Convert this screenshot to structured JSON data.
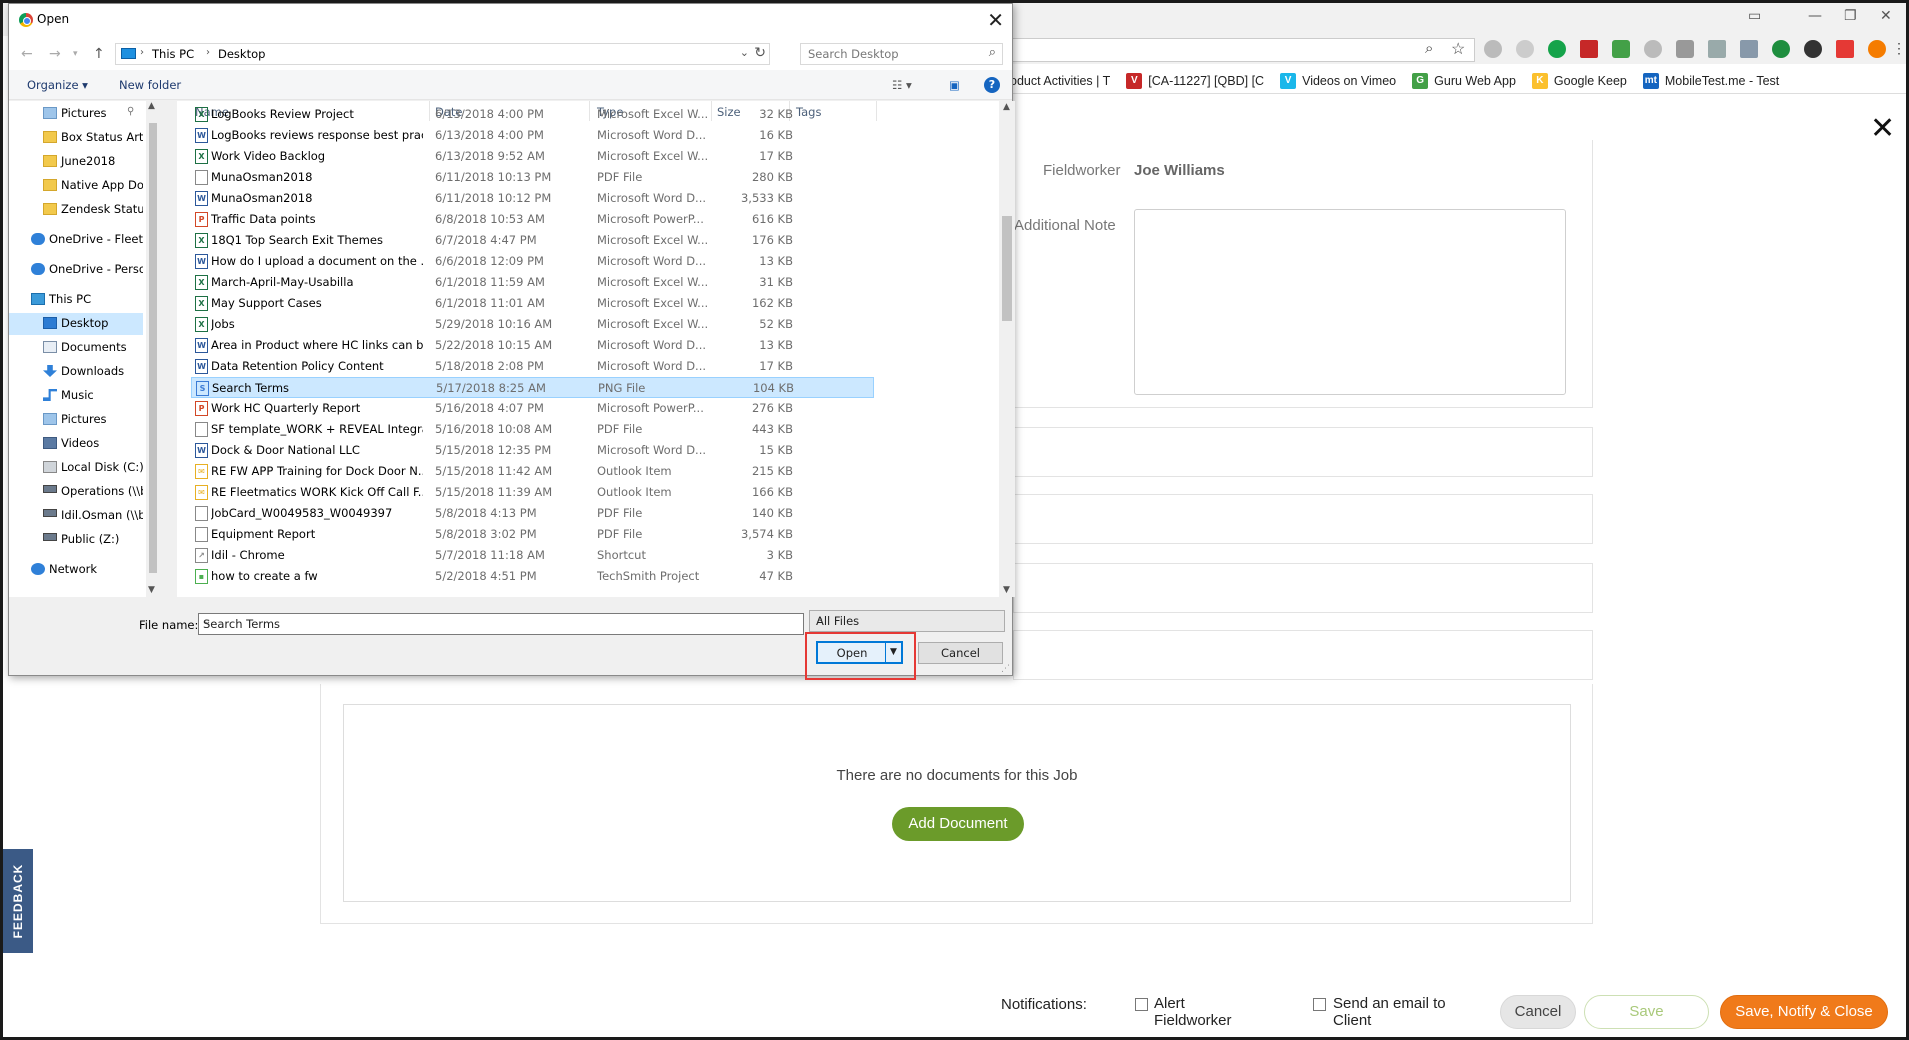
{
  "browser": {
    "minimize_glyph": "—",
    "restore_glyph": "❐",
    "close_glyph": "✕",
    "omnibox_icons": [
      "search-icon",
      "star-icon"
    ],
    "bookmarks": [
      {
        "label": "oduct Activities | T",
        "icon_color": "#888888",
        "icon": ""
      },
      {
        "label": "[CA-11227] [QBD] [C",
        "icon_color": "#c62828",
        "icon": "V"
      },
      {
        "label": "Videos on Vimeo",
        "icon_color": "#1ab7ea",
        "icon": "V"
      },
      {
        "label": "Guru Web App",
        "icon_color": "#43a047",
        "icon": "G"
      },
      {
        "label": "Google Keep",
        "icon_color": "#fbc02d",
        "icon": "K"
      },
      {
        "label": "MobileTest.me - Test",
        "icon_color": "#1565c0",
        "icon": "mt"
      }
    ]
  },
  "page": {
    "close_glyph": "✕",
    "fieldworker_label": "Fieldworker",
    "fieldworker_value": "Joe Williams",
    "additional_note_label": "Additional Note",
    "no_documents_text": "There are no documents for this Job",
    "add_document_label": "Add Document",
    "feedback_label": "FEEDBACK",
    "notifications_label": "Notifications:",
    "alert_fieldworker_label": "Alert Fieldworker",
    "alert_line1": "Alert",
    "alert_line2": "Fieldworker",
    "send_email_line1": "Send an email to",
    "send_email_line2": "Client",
    "cancel_label": "Cancel",
    "save_label": "Save",
    "save_notify_close_label": "Save, Notify & Close",
    "accent_green": "#6b9b2a",
    "accent_orange": "#f07a1a"
  },
  "dialog": {
    "title": "Open",
    "close_glyph": "✕",
    "breadcrumb": [
      "This PC",
      "Desktop"
    ],
    "search_placeholder": "Search Desktop",
    "toolbar": {
      "organize": "Organize ▾",
      "new_folder": "New folder",
      "help": "?"
    },
    "nav_items": [
      {
        "label": "Pictures",
        "kind": "folder-blue",
        "pinned": true
      },
      {
        "label": "Box Status Articl",
        "kind": "folder"
      },
      {
        "label": "June2018",
        "kind": "folder"
      },
      {
        "label": "Native App Docs",
        "kind": "folder"
      },
      {
        "label": "Zendesk Status A",
        "kind": "folder"
      },
      {
        "label": "",
        "kind": "spacer"
      },
      {
        "label": "OneDrive - Fleetm",
        "kind": "cloud"
      },
      {
        "label": "",
        "kind": "spacer"
      },
      {
        "label": "OneDrive - Persor",
        "kind": "cloud"
      },
      {
        "label": "",
        "kind": "spacer"
      },
      {
        "label": "This PC",
        "kind": "pc"
      },
      {
        "label": "Desktop",
        "kind": "desktop",
        "selected": true
      },
      {
        "label": "Documents",
        "kind": "docs"
      },
      {
        "label": "Downloads",
        "kind": "downloads"
      },
      {
        "label": "Music",
        "kind": "music"
      },
      {
        "label": "Pictures",
        "kind": "folder-blue"
      },
      {
        "label": "Videos",
        "kind": "videos"
      },
      {
        "label": "Local Disk (C:)",
        "kind": "disk"
      },
      {
        "label": "Operations (\\\\bc",
        "kind": "netdrive"
      },
      {
        "label": "Idil.Osman (\\\\bc",
        "kind": "netdrive"
      },
      {
        "label": "Public (Z:)",
        "kind": "netdrive"
      },
      {
        "label": "",
        "kind": "spacer"
      },
      {
        "label": "Network",
        "kind": "network"
      }
    ],
    "columns": [
      "Name",
      "Date",
      "Type",
      "Size",
      "Tags"
    ],
    "files": [
      {
        "name": "LogBooks Review Project",
        "date": "6/13/2018 4:00 PM",
        "type": "Microsoft Excel W...",
        "size": "32 KB",
        "icon": "excel"
      },
      {
        "name": "LogBooks reviews response best prac...",
        "date": "6/13/2018 4:00 PM",
        "type": "Microsoft Word D...",
        "size": "16 KB",
        "icon": "word"
      },
      {
        "name": "Work Video Backlog",
        "date": "6/13/2018 9:52 AM",
        "type": "Microsoft Excel W...",
        "size": "17 KB",
        "icon": "excel"
      },
      {
        "name": "MunaOsman2018",
        "date": "6/11/2018 10:13 PM",
        "type": "PDF File",
        "size": "280 KB",
        "icon": "pdf"
      },
      {
        "name": "MunaOsman2018",
        "date": "6/11/2018 10:12 PM",
        "type": "Microsoft Word D...",
        "size": "3,533 KB",
        "icon": "word"
      },
      {
        "name": "Traffic Data points",
        "date": "6/8/2018 10:53 AM",
        "type": "Microsoft PowerP...",
        "size": "616 KB",
        "icon": "ppt"
      },
      {
        "name": "18Q1 Top Search Exit Themes",
        "date": "6/7/2018 4:47 PM",
        "type": "Microsoft Excel W...",
        "size": "176 KB",
        "icon": "excel"
      },
      {
        "name": "How do I upload a document on the ...",
        "date": "6/6/2018 12:09 PM",
        "type": "Microsoft Word D...",
        "size": "13 KB",
        "icon": "word"
      },
      {
        "name": "March-April-May-Usabilla",
        "date": "6/1/2018 11:59 AM",
        "type": "Microsoft Excel W...",
        "size": "31 KB",
        "icon": "excel"
      },
      {
        "name": "May Support Cases",
        "date": "6/1/2018 11:01 AM",
        "type": "Microsoft Excel W...",
        "size": "162 KB",
        "icon": "excel"
      },
      {
        "name": "Jobs",
        "date": "5/29/2018 10:16 AM",
        "type": "Microsoft Excel W...",
        "size": "52 KB",
        "icon": "excel"
      },
      {
        "name": "Area in Product where HC links can b...",
        "date": "5/22/2018 10:15 AM",
        "type": "Microsoft Word D...",
        "size": "13 KB",
        "icon": "word"
      },
      {
        "name": "Data Retention Policy Content",
        "date": "5/18/2018 2:08 PM",
        "type": "Microsoft Word D...",
        "size": "17 KB",
        "icon": "word"
      },
      {
        "name": "Search Terms",
        "date": "5/17/2018 8:25 AM",
        "type": "PNG File",
        "size": "104 KB",
        "icon": "png",
        "selected": true
      },
      {
        "name": "Work HC Quarterly Report",
        "date": "5/16/2018 4:07 PM",
        "type": "Microsoft PowerP...",
        "size": "276 KB",
        "icon": "ppt"
      },
      {
        "name": "SF template_WORK + REVEAL Integra...",
        "date": "5/16/2018 10:08 AM",
        "type": "PDF File",
        "size": "443 KB",
        "icon": "pdf"
      },
      {
        "name": "Dock & Door National LLC",
        "date": "5/15/2018 12:35 PM",
        "type": "Microsoft Word D...",
        "size": "15 KB",
        "icon": "word"
      },
      {
        "name": "RE FW APP Training for Dock  Door N...",
        "date": "5/15/2018 11:42 AM",
        "type": "Outlook Item",
        "size": "215 KB",
        "icon": "mail"
      },
      {
        "name": "RE Fleetmatics WORK Kick Off Call F...",
        "date": "5/15/2018 11:39 AM",
        "type": "Outlook Item",
        "size": "166 KB",
        "icon": "mail"
      },
      {
        "name": "JobCard_W0049583_W0049397",
        "date": "5/8/2018 4:13 PM",
        "type": "PDF File",
        "size": "140 KB",
        "icon": "pdf"
      },
      {
        "name": "Equipment Report",
        "date": "5/8/2018 3:02 PM",
        "type": "PDF File",
        "size": "3,574 KB",
        "icon": "pdf"
      },
      {
        "name": "Idil - Chrome",
        "date": "5/7/2018 11:18 AM",
        "type": "Shortcut",
        "size": "3 KB",
        "icon": "shortcut"
      },
      {
        "name": "how to create a fw",
        "date": "5/2/2018 4:51 PM",
        "type": "TechSmith Project",
        "size": "47 KB",
        "icon": "techsmith"
      }
    ],
    "file_name_label": "File name:",
    "file_name_value": "Search Terms",
    "filter_value": "All Files",
    "open_label": "Open",
    "cancel_label": "Cancel",
    "icon_colors": {
      "excel": "#1d7044",
      "word": "#2b579a",
      "pdf": "#888888",
      "ppt": "#d24726",
      "png": "#3a7bd5",
      "mail": "#e8b023",
      "shortcut": "#888888",
      "techsmith": "#4caf50"
    }
  }
}
